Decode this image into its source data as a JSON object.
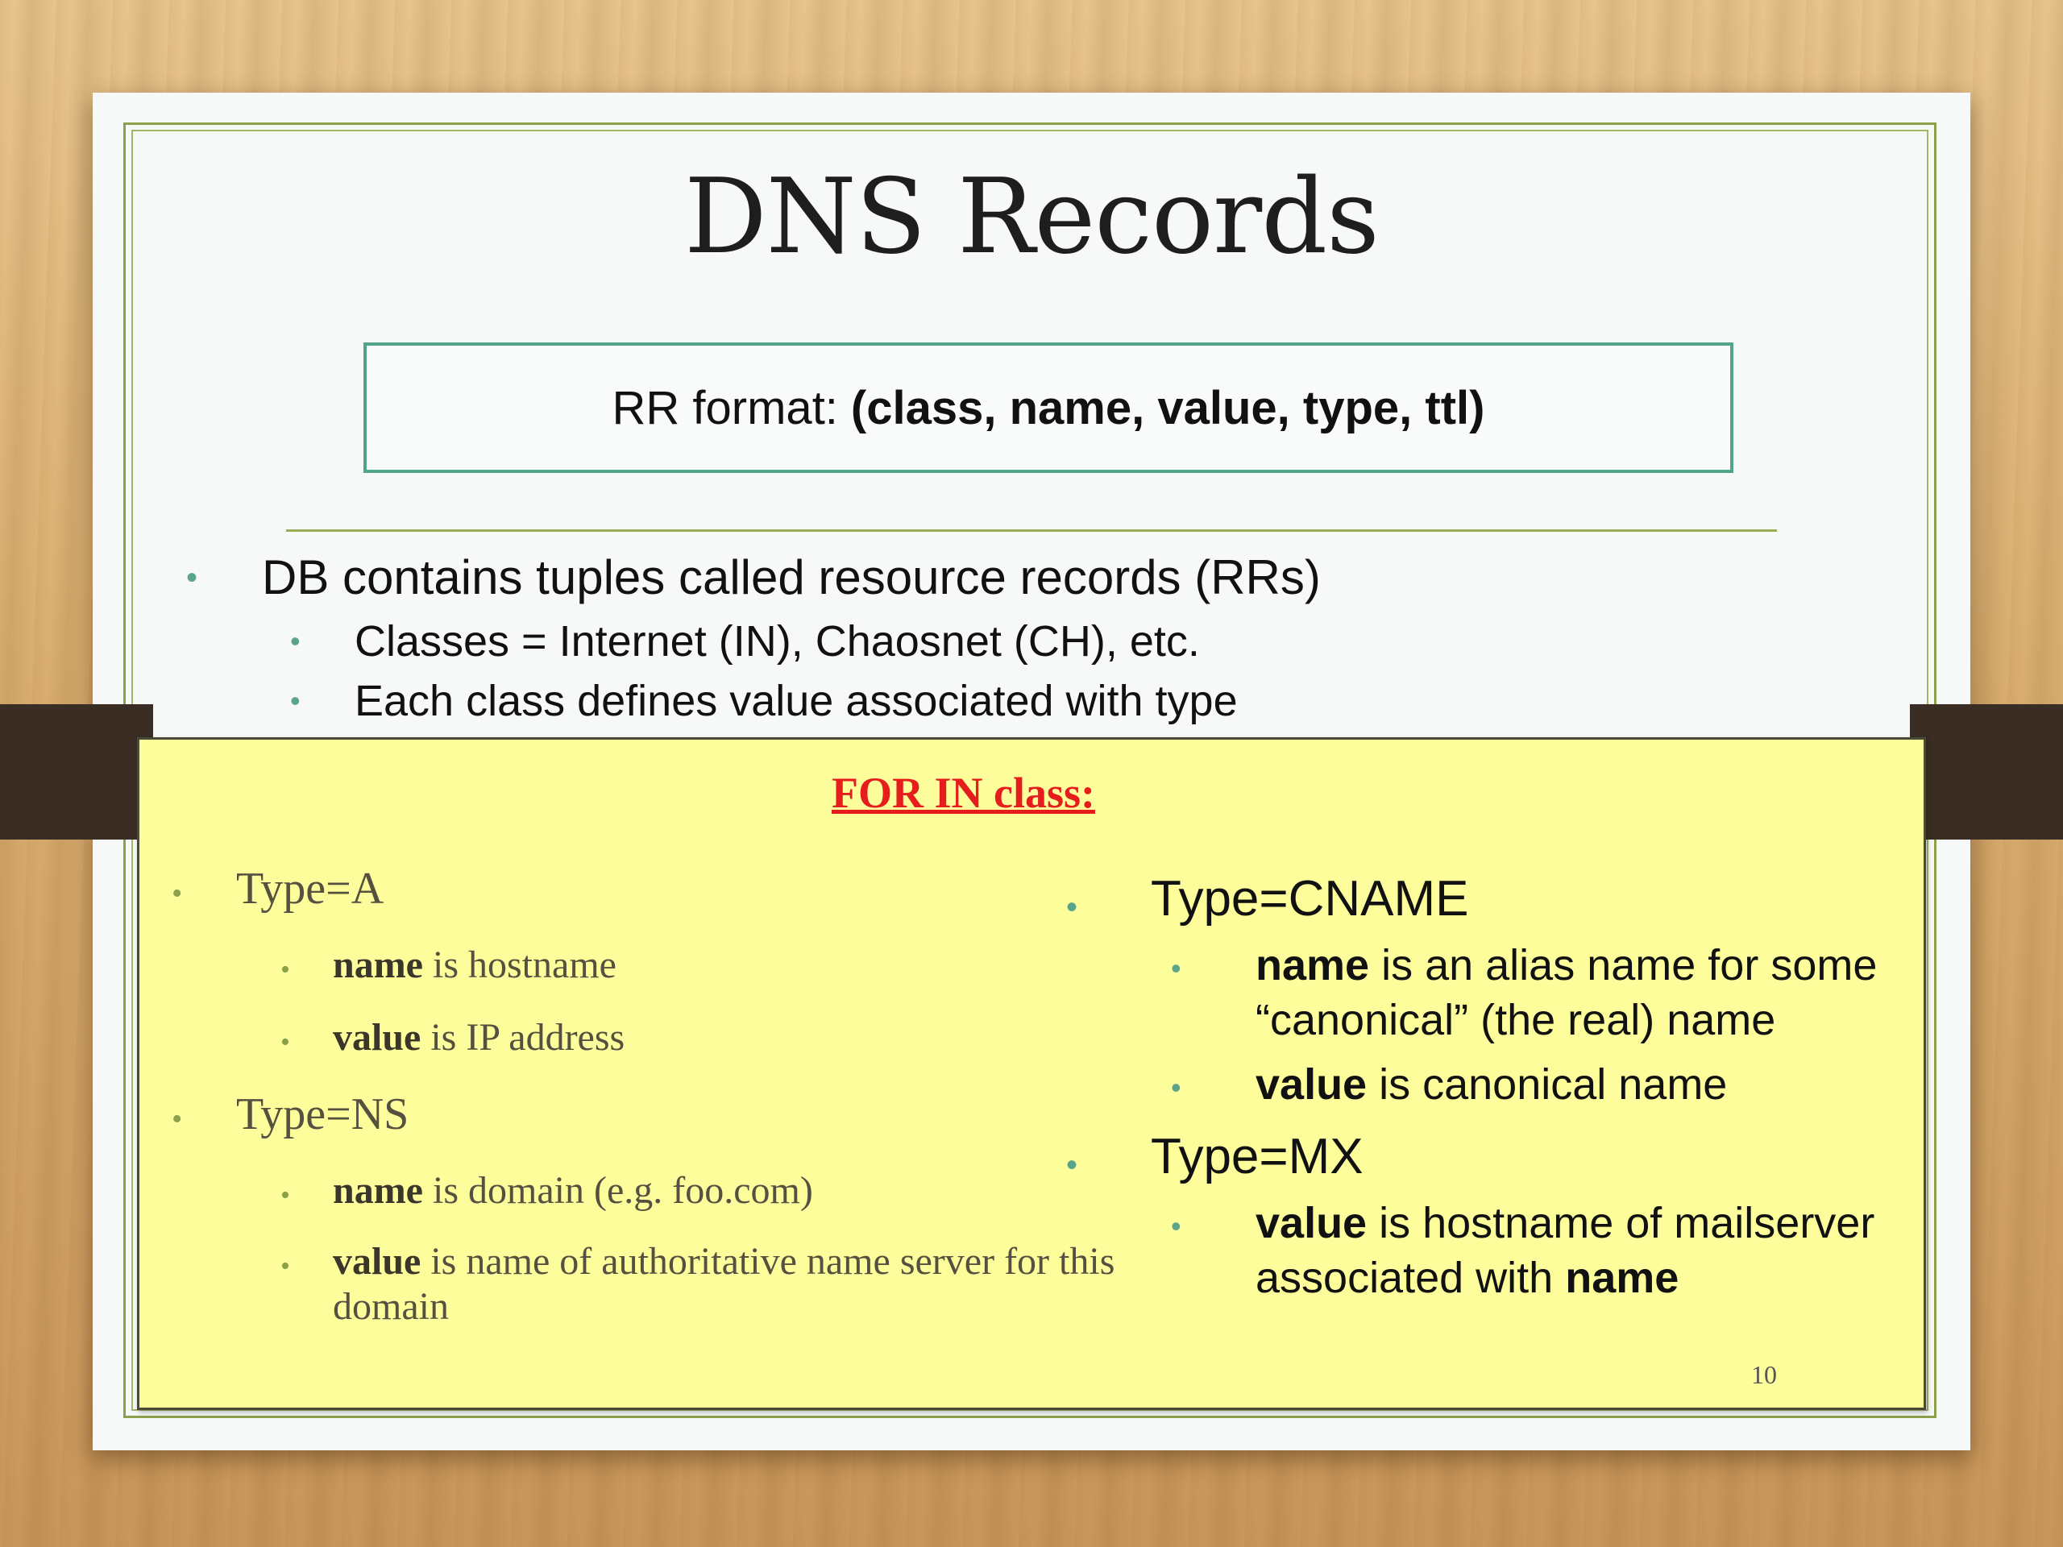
{
  "slide": {
    "title": "DNS Records",
    "rr_format_label": "RR format:",
    "rr_format_value": "(class, name, value, type, ttl)",
    "bullets": [
      "DB contains tuples called resource records (RRs)",
      "Classes = Internet (IN), Chaosnet (CH), etc.",
      "Each class defines value associated with type"
    ],
    "bullet_glyph": "•"
  },
  "note": {
    "title": "FOR IN class:",
    "left": {
      "type_a": "Type=A",
      "a_name_bold": "name",
      "a_name_rest": " is hostname",
      "a_value_bold": "value",
      "a_value_rest": " is IP address",
      "type_ns": "Type=NS",
      "ns_name_bold": "name",
      "ns_name_rest": " is domain (e.g. foo.com)",
      "ns_value_bold": "value",
      "ns_value_rest": " is name of authoritative name server for this domain"
    },
    "right": {
      "type_cname": "Type=CNAME",
      "cname_name_bold": "name",
      "cname_name_rest": " is an alias name for some “canonical” (the real) name",
      "cname_value_bold": "value",
      "cname_value_rest": " is canonical name",
      "type_mx": "Type=MX",
      "mx_value_bold": "value",
      "mx_value_rest": " is hostname of mailserver associated with ",
      "mx_name_bold": "name"
    },
    "page_number": "10"
  }
}
